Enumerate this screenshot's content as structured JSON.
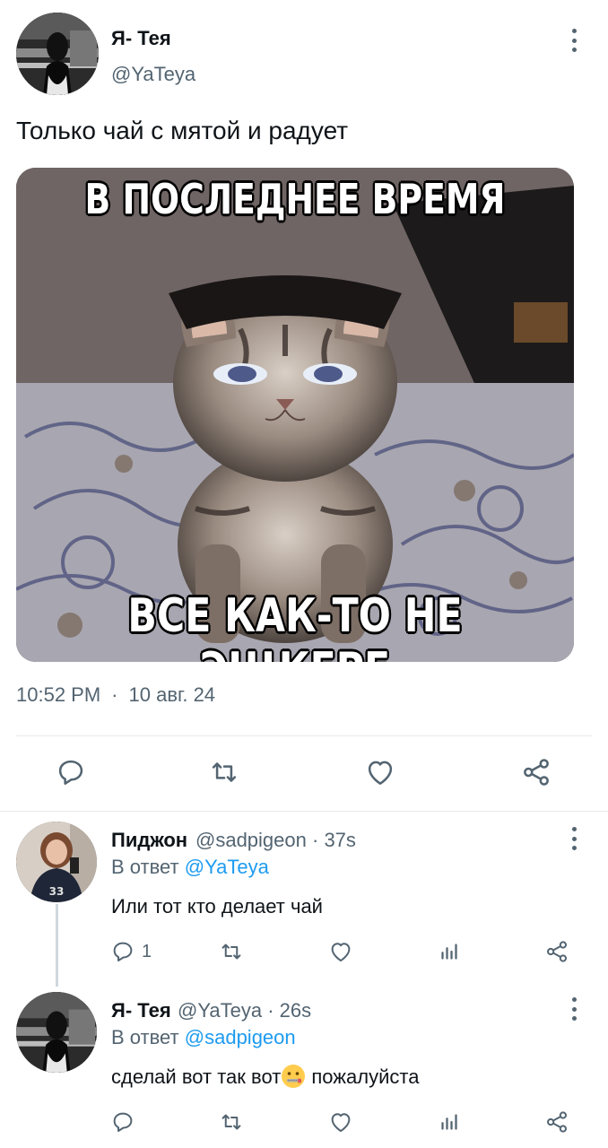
{
  "main_tweet": {
    "author_name": "Я- Тея",
    "author_handle": "@YaTeya",
    "text": "Только чай с мятой и радует",
    "meme_top": "В ПОСЛЕДНЕЕ ВРЕМЯ",
    "meme_bottom": "ВСЕ КАК-ТО НЕ ЭЩКЕРЕ",
    "time": "10:52 PM",
    "separator": "·",
    "date": "10 авг. 24"
  },
  "replies": [
    {
      "author_name": "Пиджон",
      "author_handle": "@sadpigeon",
      "time": "· 37s",
      "reply_prefix": "В ответ",
      "reply_mention": "@YaTeya",
      "text": "Или тот кто делает чай",
      "reply_count": "1"
    },
    {
      "author_name": "Я- Тея",
      "author_handle": "@YaTeya",
      "time": "· 26s",
      "reply_prefix": "В ответ",
      "reply_mention": "@sadpigeon",
      "text_before": "сделай вот так вот",
      "text_after": " пожалуйста",
      "emoji": "zipper-mouth-face"
    }
  ],
  "colors": {
    "accent": "#1d9bf0",
    "secondary_text": "#536471",
    "primary_text": "#0f1419",
    "divider": "#e6e9eb"
  }
}
